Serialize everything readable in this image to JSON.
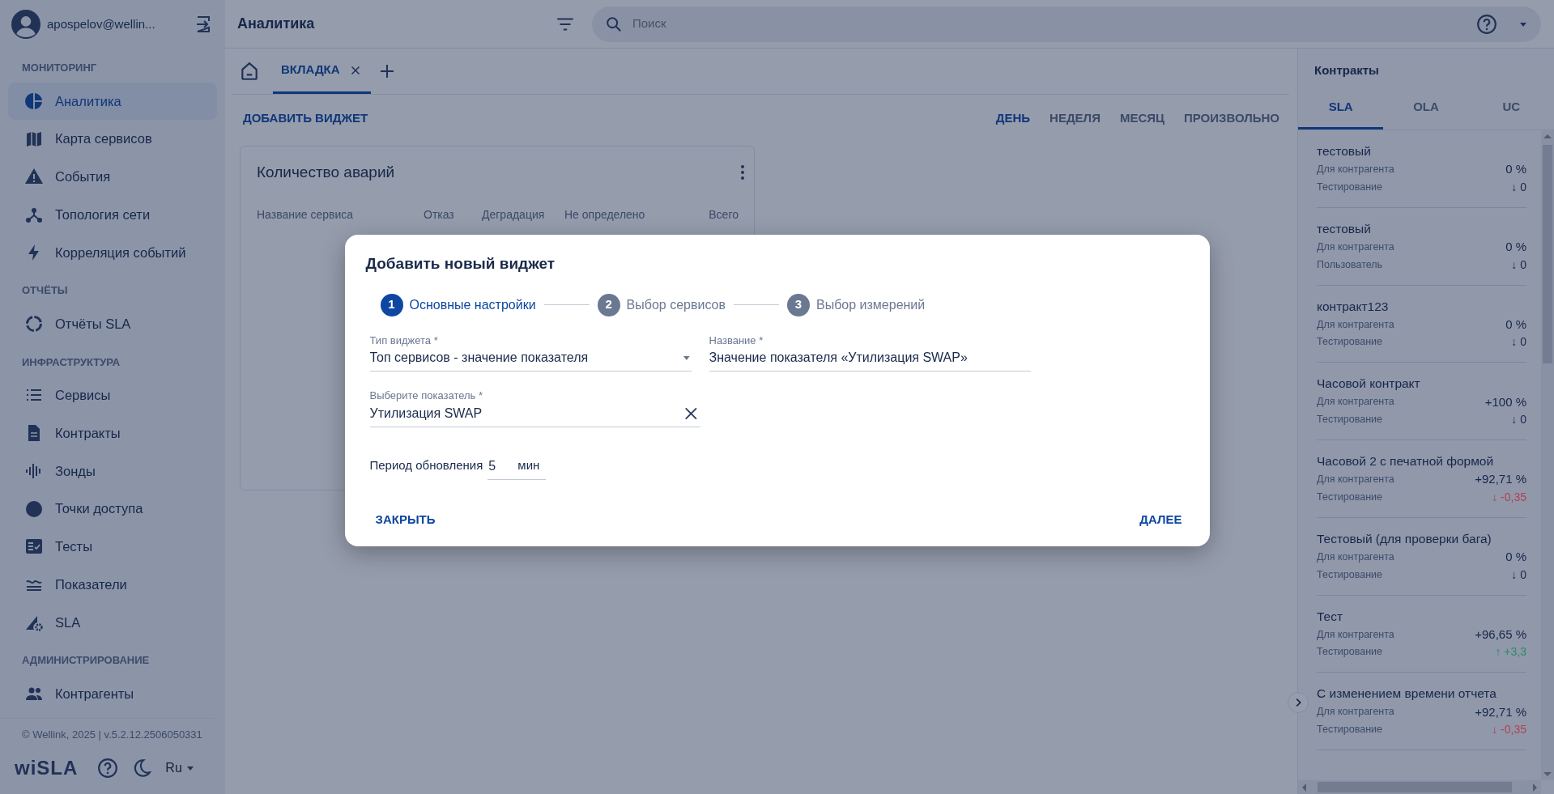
{
  "user": {
    "name": "apospelov@wellin..."
  },
  "sidebar": {
    "sections": [
      {
        "title": "МОНИТОРИНГ",
        "items": [
          {
            "label": "Аналитика",
            "selected": true
          },
          {
            "label": "Карта сервисов",
            "selected": false
          },
          {
            "label": "События",
            "selected": false
          },
          {
            "label": "Топология сети",
            "selected": false
          },
          {
            "label": "Корреляция событий",
            "selected": false
          }
        ]
      },
      {
        "title": "ОТЧЁТЫ",
        "items": [
          {
            "label": "Отчёты SLA",
            "selected": false
          }
        ]
      },
      {
        "title": "ИНФРАСТРУКТУРА",
        "items": [
          {
            "label": "Сервисы",
            "selected": false
          },
          {
            "label": "Контракты",
            "selected": false
          },
          {
            "label": "Зонды",
            "selected": false
          },
          {
            "label": "Точки доступа",
            "selected": false
          },
          {
            "label": "Тесты",
            "selected": false
          },
          {
            "label": "Показатели",
            "selected": false
          },
          {
            "label": "SLA",
            "selected": false
          }
        ]
      },
      {
        "title": "АДМИНИСТРИРОВАНИЕ",
        "items": [
          {
            "label": "Контрагенты",
            "selected": false
          }
        ]
      }
    ],
    "copyright": "© Wellink, 2025 | v.5.2.12.2506050331",
    "logo": "wiSLA",
    "language": "Ru"
  },
  "header": {
    "title": "Аналитика",
    "search": {
      "placeholder": "Поиск"
    }
  },
  "tabs": [
    {
      "label": "ВКЛАДКА",
      "selected": true
    }
  ],
  "toolbar": {
    "add_button": "ДОБАВИТЬ ВИДЖЕТ",
    "periods": [
      {
        "label": "ДЕНЬ",
        "selected": true
      },
      {
        "label": "НЕДЕЛЯ",
        "selected": false
      },
      {
        "label": "МЕСЯЦ",
        "selected": false
      },
      {
        "label": "ПРОИЗВОЛЬНО",
        "selected": false
      }
    ]
  },
  "widget": {
    "title": "Количество аварий",
    "columns": [
      "Название сервиса",
      "Отказ",
      "Деградация",
      "Не определено",
      "Всего"
    ]
  },
  "contracts": {
    "title": "Контракты",
    "tabs": [
      {
        "label": "SLA",
        "selected": true
      },
      {
        "label": "OLA",
        "selected": false
      },
      {
        "label": "UC",
        "selected": false
      }
    ],
    "items": [
      {
        "name": "тестовый",
        "party": "Для контрагента",
        "value": "0 %",
        "category": "Тестирование",
        "change": "↓ 0",
        "color": "#1a2a4a"
      },
      {
        "name": "тестовый",
        "party": "Для контрагента",
        "value": "0 %",
        "category": "Пользователь",
        "change": "↓ 0",
        "color": "#1a2a4a"
      },
      {
        "name": "контракт123",
        "party": "Для контрагента",
        "value": "0 %",
        "category": "Тестирование",
        "change": "↓ 0",
        "color": "#1a2a4a"
      },
      {
        "name": "Часовой контракт",
        "party": "Для контрагента",
        "value": "+100 %",
        "category": "Тестирование",
        "change": "↓ 0",
        "color": "#1a2a4a"
      },
      {
        "name": "Часовой 2 с печатной формой",
        "party": "Для контрагента",
        "value": "+92,71 %",
        "category": "Тестирование",
        "change": "↓ -0,35",
        "color": "#b3424f"
      },
      {
        "name": "Тестовый (для проверки бага)",
        "party": "Для контрагента",
        "value": "0 %",
        "category": "Тестирование",
        "change": "↓ 0",
        "color": "#1a2a4a"
      },
      {
        "name": "Тест",
        "party": "Для контрагента",
        "value": "+96,65 %",
        "category": "Тестирование",
        "change": "↑ +3,3",
        "color": "#2d8a64"
      },
      {
        "name": "С изменением времени отчета",
        "party": "Для контрагента",
        "value": "+92,71 %",
        "category": "Тестирование",
        "change": "↓ -0,35",
        "color": "#b3424f"
      }
    ]
  },
  "dialog": {
    "title": "Добавить новый виджет",
    "steps": [
      {
        "number": "1",
        "label": "Основные настройки",
        "selected": true
      },
      {
        "number": "2",
        "label": "Выбор сервисов",
        "selected": false
      },
      {
        "number": "3",
        "label": "Выбор измерений",
        "selected": false
      }
    ],
    "widget_type": {
      "label": "Тип виджета *",
      "value": "Топ сервисов - значение показателя"
    },
    "name": {
      "label": "Название *",
      "value": "Значение показателя «Утилизация SWAP»"
    },
    "indicator": {
      "label": "Выберите показатель *",
      "value": "Утилизация SWAP"
    },
    "period": {
      "label": "Период обновления",
      "value": "5",
      "unit": "мин"
    },
    "buttons": {
      "close": "ЗАКРЫТЬ",
      "next": "ДАЛЕЕ"
    }
  }
}
